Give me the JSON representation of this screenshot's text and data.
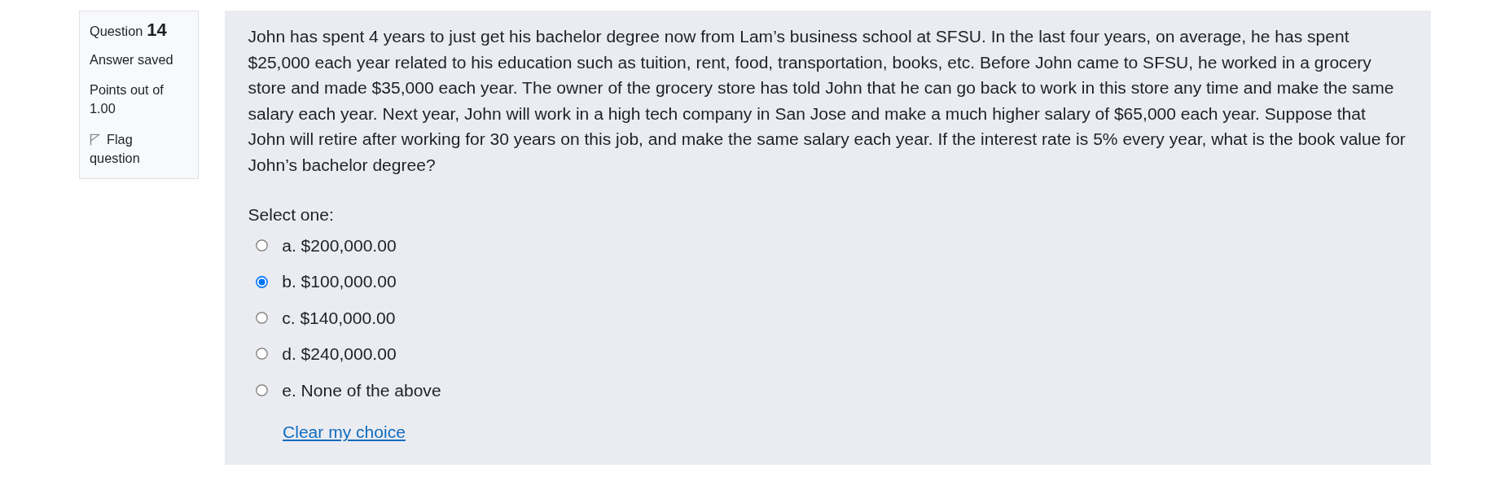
{
  "question_info": {
    "label": "Question",
    "number": "14",
    "state": "Answer saved",
    "grade": "Points out of 1.00",
    "flag": {
      "label": "Flag question",
      "flagged": false
    }
  },
  "question": {
    "text": "John has spent 4 years to just get his bachelor degree now from Lam’s business school at SFSU. In the last four years, on average, he has spent $25,000 each year related to his education such as tuition, rent, food, transportation, books, etc. Before John came to SFSU, he worked in a grocery store and made $35,000 each year. The owner of the grocery store has told John that he can go back to work in this store any time and make the same salary each year. Next year, John will work in a high tech company in San Jose and make a much higher salary of $65,000 each year. Suppose that John will retire after working for 30 years on this job, and make the same salary each year. If the interest rate is 5% every year, what is the book value for John’s bachelor degree?",
    "prompt": "Select one:",
    "options": [
      {
        "label": "a. $200,000.00",
        "selected": false
      },
      {
        "label": "b. $100,000.00",
        "selected": true
      },
      {
        "label": "c. $140,000.00",
        "selected": false
      },
      {
        "label": "d. $240,000.00",
        "selected": false
      },
      {
        "label": "e. None of the above",
        "selected": false
      }
    ],
    "clear_link": "Clear my choice"
  }
}
